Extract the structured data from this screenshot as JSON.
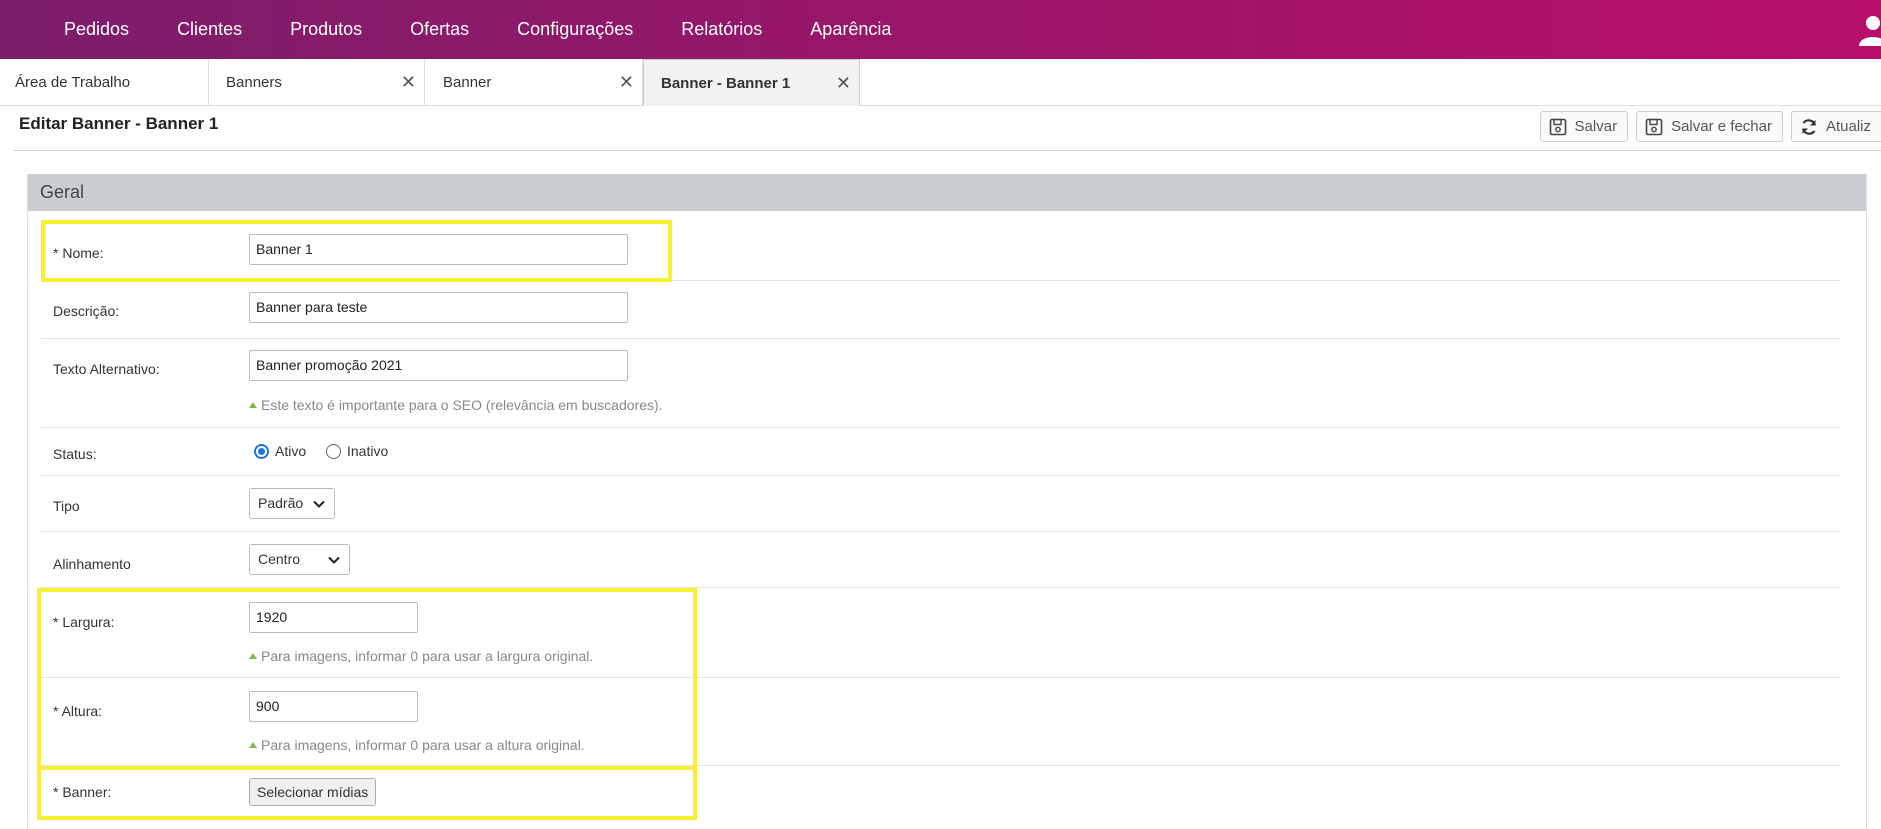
{
  "nav": {
    "items": [
      "Pedidos",
      "Clientes",
      "Produtos",
      "Ofertas",
      "Configurações",
      "Relatórios",
      "Aparência"
    ]
  },
  "tabs": [
    {
      "label": "Área de Trabalho"
    },
    {
      "label": "Banners"
    },
    {
      "label": "Banner"
    },
    {
      "label": "Banner - Banner 1"
    }
  ],
  "page": {
    "title": "Editar Banner - Banner 1",
    "save": "Salvar",
    "save_close": "Salvar e fechar",
    "refresh": "Atualiz"
  },
  "panel": {
    "title": "Geral"
  },
  "form": {
    "nome": {
      "label": "* Nome:",
      "value": "Banner 1"
    },
    "descricao": {
      "label": "Descrição:",
      "value": "Banner para teste"
    },
    "texto_alt": {
      "label": "Texto Alternativo:",
      "value": "Banner promoção 2021",
      "hint": "Este texto é importante para o SEO (relevância em buscadores)."
    },
    "status": {
      "label": "Status:",
      "ativo": "Ativo",
      "inativo": "Inativo",
      "selected": "Ativo"
    },
    "tipo": {
      "label": "Tipo",
      "value": "Padrão"
    },
    "alinhamento": {
      "label": "Alinhamento",
      "value": "Centro"
    },
    "largura": {
      "label": "* Largura:",
      "value": "1920",
      "hint": "Para imagens, informar 0 para usar a largura original."
    },
    "altura": {
      "label": "* Altura:",
      "value": "900",
      "hint": "Para imagens, informar 0 para usar a altura original."
    },
    "banner": {
      "label": "* Banner:",
      "button": "Selecionar mídias"
    }
  },
  "colors": {
    "nav_start": "#7b1e6b",
    "nav_end": "#b8106a",
    "highlight": "#f8f032",
    "panel_head": "#c9ced3"
  }
}
